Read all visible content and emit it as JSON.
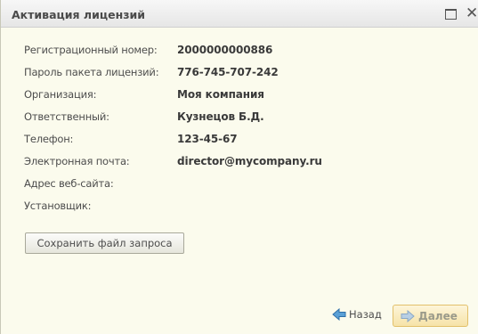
{
  "window": {
    "title": "Активация лицензий"
  },
  "fields": [
    {
      "label": "Регистрационный номер:",
      "value": "2000000000886"
    },
    {
      "label": "Пароль пакета лицензий:",
      "value": "776-745-707-242"
    },
    {
      "label": "Организация:",
      "value": "Моя компания"
    },
    {
      "label": "Ответственный:",
      "value": "Кузнецов Б.Д."
    },
    {
      "label": "Телефон:",
      "value": "123-45-67"
    },
    {
      "label": "Электронная почта:",
      "value": "director@mycompany.ru"
    },
    {
      "label": "Адрес веб-сайта:",
      "value": ""
    },
    {
      "label": "Установщик:",
      "value": ""
    }
  ],
  "actions": {
    "save_request": "Сохранить файл запроса",
    "back": "Назад",
    "next": "Далее"
  },
  "icons": {
    "maximize": "maximize-icon",
    "close": "close-icon",
    "back": "arrow-left-icon",
    "next": "arrow-right-icon"
  },
  "colors": {
    "background": "#fbfbed",
    "titlebar": "#e9e9e9",
    "next_button": "#f6e3a8",
    "arrow_blue": "#4a90c8"
  }
}
